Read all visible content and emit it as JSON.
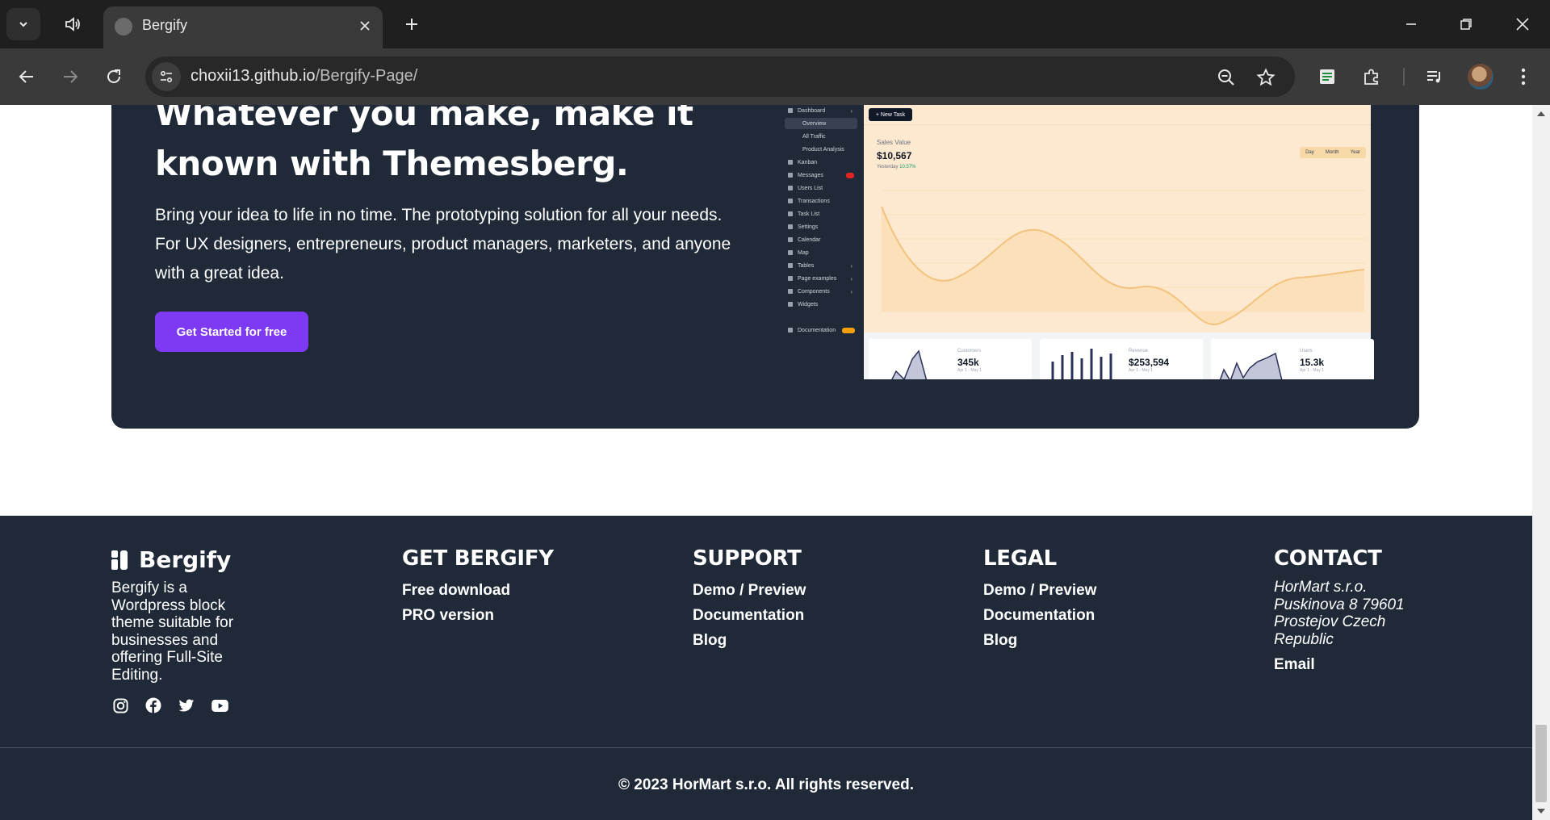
{
  "browser": {
    "tab_title": "Bergify",
    "url_host": "choxii13.github.io",
    "url_path": "/Bergify-Page/"
  },
  "hero": {
    "title": "Whatever you make, make it known with Themesberg.",
    "text": "Bring your idea to life in no time. The prototyping solution for all your needs. For UX designers, entrepreneurs, product managers, marketers, and anyone with a great idea.",
    "cta_label": "Get Started for free"
  },
  "mockup": {
    "sidebar": [
      "Dashboard",
      "Overview",
      "All Traffic",
      "Product Analysis",
      "Kanban",
      "Messages",
      "Users List",
      "Transactions",
      "Task List",
      "Settings",
      "Calendar",
      "Map",
      "Tables",
      "Page examples",
      "Components",
      "Widgets",
      "Documentation"
    ],
    "new_task": "+ New Task",
    "sales_label": "Sales Value",
    "sales_value": "$10,567",
    "sales_sub": "Yesterday",
    "sales_change": "10.57%",
    "range": [
      "Day",
      "Month",
      "Year"
    ],
    "cards": [
      {
        "label": "Customers",
        "value": "345k",
        "sub": "Apr 1 - May 1"
      },
      {
        "label": "Revenue",
        "value": "$253,594",
        "sub": "Apr 1 - May 1"
      },
      {
        "label": "Users",
        "value": "15.3k",
        "sub": "Apr 1 - May 1"
      }
    ]
  },
  "footer": {
    "brand": {
      "name": "Bergify",
      "description": "Bergify is a Wordpress block theme suitable for businesses and offering Full-Site Editing."
    },
    "social_icons": [
      "instagram-icon",
      "facebook-icon",
      "twitter-icon",
      "youtube-icon"
    ],
    "get_bergify": {
      "heading": "GET BERGIFY",
      "links": [
        "Free download",
        "PRO version"
      ]
    },
    "support": {
      "heading": "SUPPORT",
      "links": [
        "Demo / Preview",
        "Documentation",
        "Blog"
      ]
    },
    "legal": {
      "heading": "LEGAL",
      "links": [
        "Demo / Preview",
        "Documentation",
        "Blog"
      ]
    },
    "contact": {
      "heading": "CONTACT",
      "address": "HorMart s.r.o. Puskinova 8 79601 Prostejov Czech Republic",
      "email": "Email"
    },
    "copyright": "© 2023 HorMart s.r.o. All rights reserved."
  },
  "colors": {
    "dark_bg": "#1f2937",
    "accent": "#7e3af2"
  }
}
